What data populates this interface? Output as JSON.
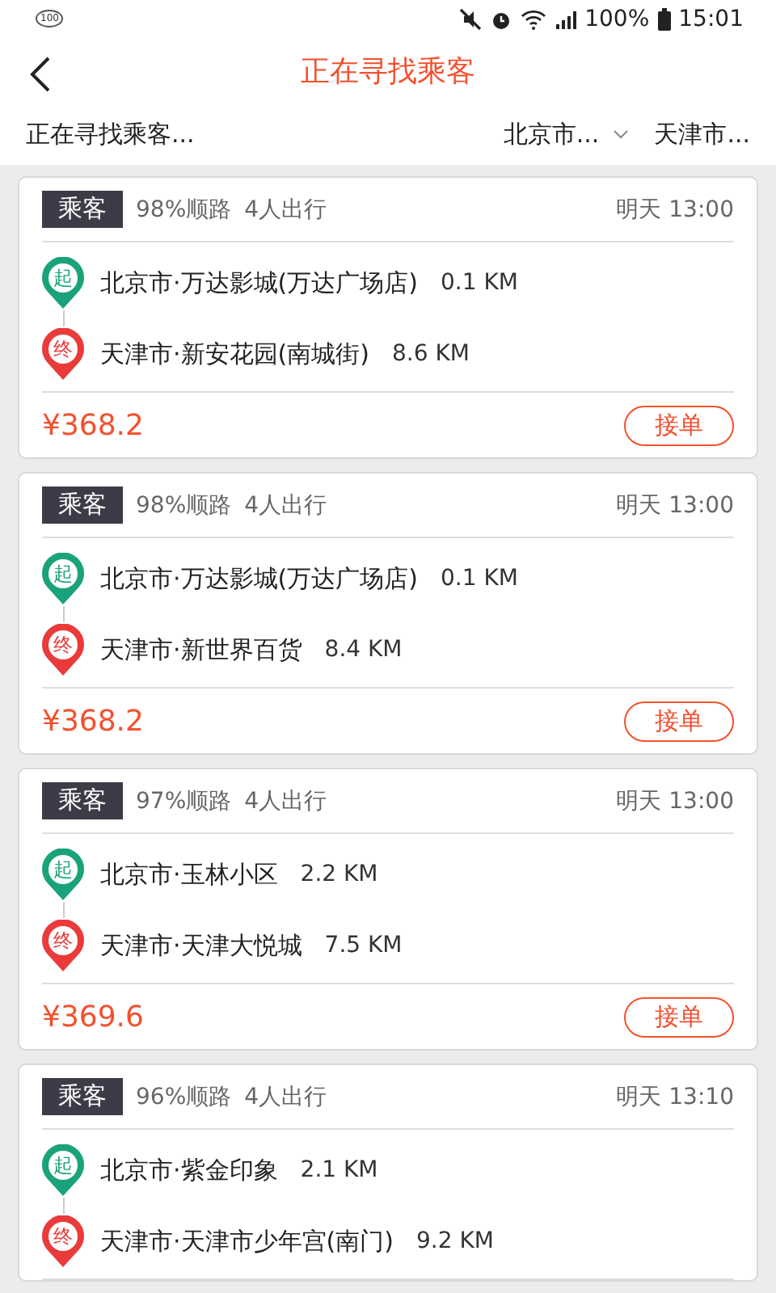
{
  "status_bar": {
    "badge": "100",
    "battery": "100%",
    "time": "15:01"
  },
  "header": {
    "title": "正在寻找乘客"
  },
  "filter_bar": {
    "status": "正在寻找乘客...",
    "from": "北京市...",
    "to": "天津市..."
  },
  "cards": [
    {
      "tag": "乘客",
      "match": "98%顺路",
      "people": "4人出行",
      "time": "明天 13:00",
      "start_mark": "起",
      "start": "北京市·万达影城(万达广场店)",
      "start_distance": "0.1 KM",
      "end_mark": "终",
      "end": "天津市·新安花园(南城街)",
      "end_distance": "8.6 KM",
      "price": "¥368.2",
      "action": "接单"
    },
    {
      "tag": "乘客",
      "match": "98%顺路",
      "people": "4人出行",
      "time": "明天 13:00",
      "start_mark": "起",
      "start": "北京市·万达影城(万达广场店)",
      "start_distance": "0.1 KM",
      "end_mark": "终",
      "end": "天津市·新世界百货",
      "end_distance": "8.4 KM",
      "price": "¥368.2",
      "action": "接单"
    },
    {
      "tag": "乘客",
      "match": "97%顺路",
      "people": "4人出行",
      "time": "明天 13:00",
      "start_mark": "起",
      "start": "北京市·玉林小区",
      "start_distance": "2.2 KM",
      "end_mark": "终",
      "end": "天津市·天津大悦城",
      "end_distance": "7.5 KM",
      "price": "¥369.6",
      "action": "接单"
    },
    {
      "tag": "乘客",
      "match": "96%顺路",
      "people": "4人出行",
      "time": "明天 13:10",
      "start_mark": "起",
      "start": "北京市·紫金印象",
      "start_distance": "2.1 KM",
      "end_mark": "终",
      "end": "天津市·天津市少年宫(南门)",
      "end_distance": "9.2 KM"
    }
  ]
}
